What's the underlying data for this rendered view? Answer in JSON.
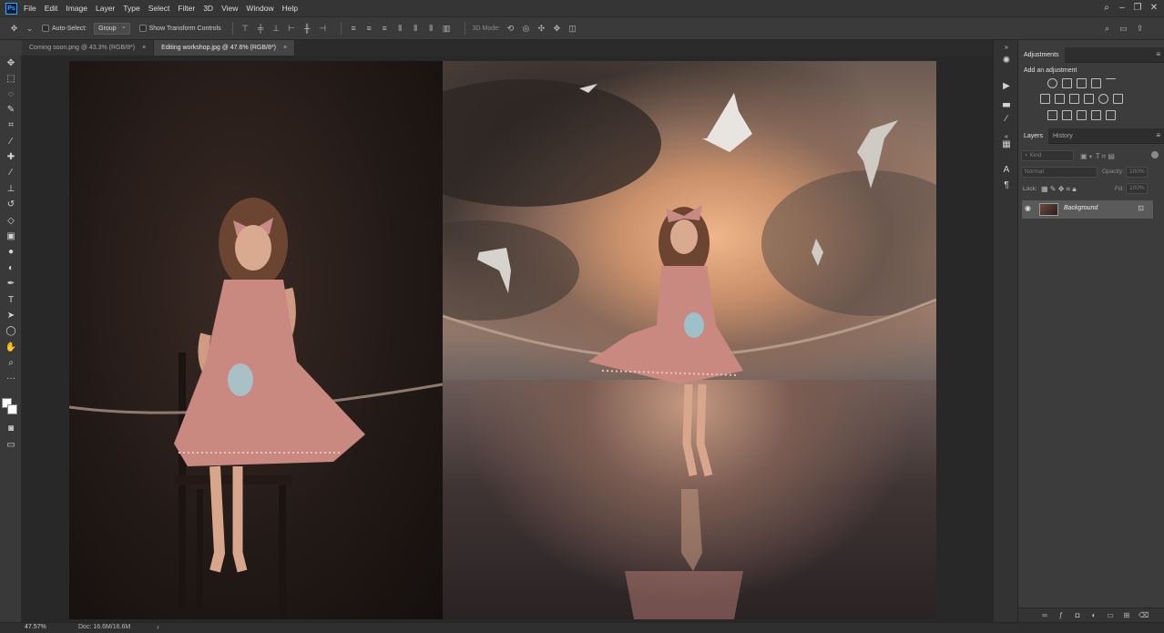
{
  "app": {
    "logo": "Ps",
    "menu": [
      "File",
      "Edit",
      "Image",
      "Layer",
      "Type",
      "Select",
      "Filter",
      "3D",
      "View",
      "Window",
      "Help"
    ]
  },
  "options_bar": {
    "auto_select_label": "Auto-Select:",
    "auto_select_value": "Group",
    "show_transform_label": "Show Transform Controls",
    "mode_3d_label": "3D Mode:"
  },
  "tabs": [
    {
      "label": "Coming soon.png @ 43.3% (RGB/8*)",
      "close": "×",
      "active": false
    },
    {
      "label": "Editing workshop.jpg @ 47.6% (RGB/8*)",
      "close": "×",
      "active": true
    }
  ],
  "panels": {
    "adjustments": {
      "tab": "Adjustments",
      "subtitle": "Add an adjustment"
    },
    "layers": {
      "tabs": [
        "Layers",
        "History"
      ],
      "kind_placeholder": "Kind",
      "blend_mode": "Normal",
      "opacity_label": "Opacity:",
      "opacity_value": "100%",
      "lock_label": "Lock:",
      "fill_label": "Fill:",
      "fill_value": "100%",
      "layer_name": "Background"
    }
  },
  "status": {
    "zoom": "47.57%",
    "doc": "Doc: 16.6M/16.6M",
    "arrow": "›"
  },
  "icons": {
    "tools": [
      "move-icon",
      "marquee-icon",
      "lasso-icon",
      "quick-select-icon",
      "crop-icon",
      "eyedropper-icon",
      "healing-icon",
      "brush-icon",
      "stamp-icon",
      "history-brush-icon",
      "eraser-icon",
      "gradient-icon",
      "blur-icon",
      "dodge-icon",
      "pen-icon",
      "type-icon",
      "path-select-icon",
      "shape-icon",
      "hand-icon",
      "zoom-icon"
    ]
  }
}
